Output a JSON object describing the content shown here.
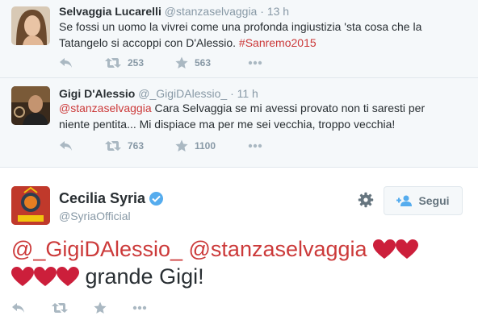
{
  "tweets": [
    {
      "name": "Selvaggia Lucarelli",
      "handle": "@stanzaselvaggia",
      "separator": "·",
      "time": "13 h",
      "text_line1": "Se fossi un uomo la vivrei come una profonda ingiustizia 'sta cosa che la",
      "text_line2_pre": "Tatangelo si accoppi con D'Alessio. ",
      "hashtag": "#Sanremo2015",
      "retweets": "253",
      "favorites": "563"
    },
    {
      "name": "Gigi D'Alessio",
      "handle": "@_GigiDAlessio_",
      "separator": "·",
      "time": "11 h",
      "mention": "@stanzaselvaggia",
      "text_line1_post": " Cara Selvaggia se mi avessi provato non ti saresti per",
      "text_line2": "niente pentita... Mi dispiace ma per me sei vecchia, troppo vecchia!",
      "retweets": "763",
      "favorites": "1100"
    }
  ],
  "main": {
    "name": "Cecilia Syria",
    "handle": "@SyriaOfficial",
    "follow_label": "Segui",
    "mention1": "@_GigiDAlessio_",
    "mention2": "@stanzaselvaggia",
    "text_tail": " grande Gigi!",
    "heart_color": "#cc1f3b"
  },
  "colors": {
    "accent": "#cc3a3a",
    "icon": "#aab8c2",
    "muted": "#8899a6",
    "verified": "#55acee"
  },
  "icons": [
    "reply-icon",
    "retweet-icon",
    "favorite-icon",
    "more-icon",
    "gear-icon",
    "verified-icon",
    "follow-icon",
    "heart-icon"
  ]
}
